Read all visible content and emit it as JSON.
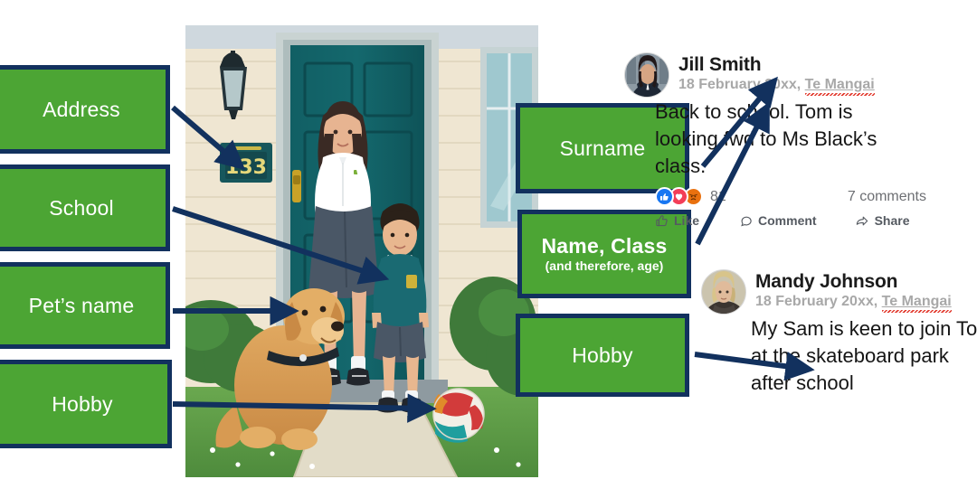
{
  "left_callouts": [
    {
      "label": "Address",
      "name": "callout-address"
    },
    {
      "label": "School",
      "name": "callout-school"
    },
    {
      "label": "Pet’s name",
      "name": "callout-pets-name"
    },
    {
      "label": "Hobby",
      "name": "callout-hobby-left"
    }
  ],
  "right_callouts": [
    {
      "label": "Surname",
      "sub": ""
    },
    {
      "label": "Name, Class",
      "sub": "(and therefore, age)"
    },
    {
      "label": "Hobby",
      "sub": ""
    }
  ],
  "illustration": {
    "alt": "Cartoon illustration of a mother and schoolboy standing at the front door of a house with a golden retriever dog and a ball on the path",
    "house_number": "133",
    "elements": [
      "porch-light",
      "mailbox",
      "front-door",
      "mother",
      "schoolboy",
      "golden-retriever",
      "ball",
      "window",
      "shrubs",
      "lawn"
    ]
  },
  "feed": {
    "posts": [
      {
        "author": "Jill Smith",
        "date": "18 February 20xx,",
        "location": "Te Mangai",
        "body_lines": [
          "Back to school.  Tom is",
          "looking fwd to Ms Black’s",
          "class."
        ],
        "reactions": {
          "count": "81",
          "types": [
            "like",
            "love",
            "angry"
          ]
        },
        "comments": "7 comments",
        "actions": [
          "Like",
          "Comment",
          "Share"
        ],
        "avatar_alt": "Photo of a woman with dark hair in a dark blazer"
      },
      {
        "author": "Mandy Johnson",
        "date": "18 February 20xx,",
        "location": "Te Mangai",
        "body_lines": [
          "My Sam is keen to join Tom",
          "at the skateboard park",
          "after school"
        ],
        "avatar_alt": "Photo of a person with short blonde hair in a dark top"
      }
    ]
  },
  "colors": {
    "callout_fill": "#4CA534",
    "callout_border": "#12315E",
    "arrow": "#12315E",
    "meta_text": "#a8a8a8",
    "reaction_like": "#1877F2",
    "reaction_love": "#F33E58",
    "reaction_angry": "#E9710F"
  }
}
